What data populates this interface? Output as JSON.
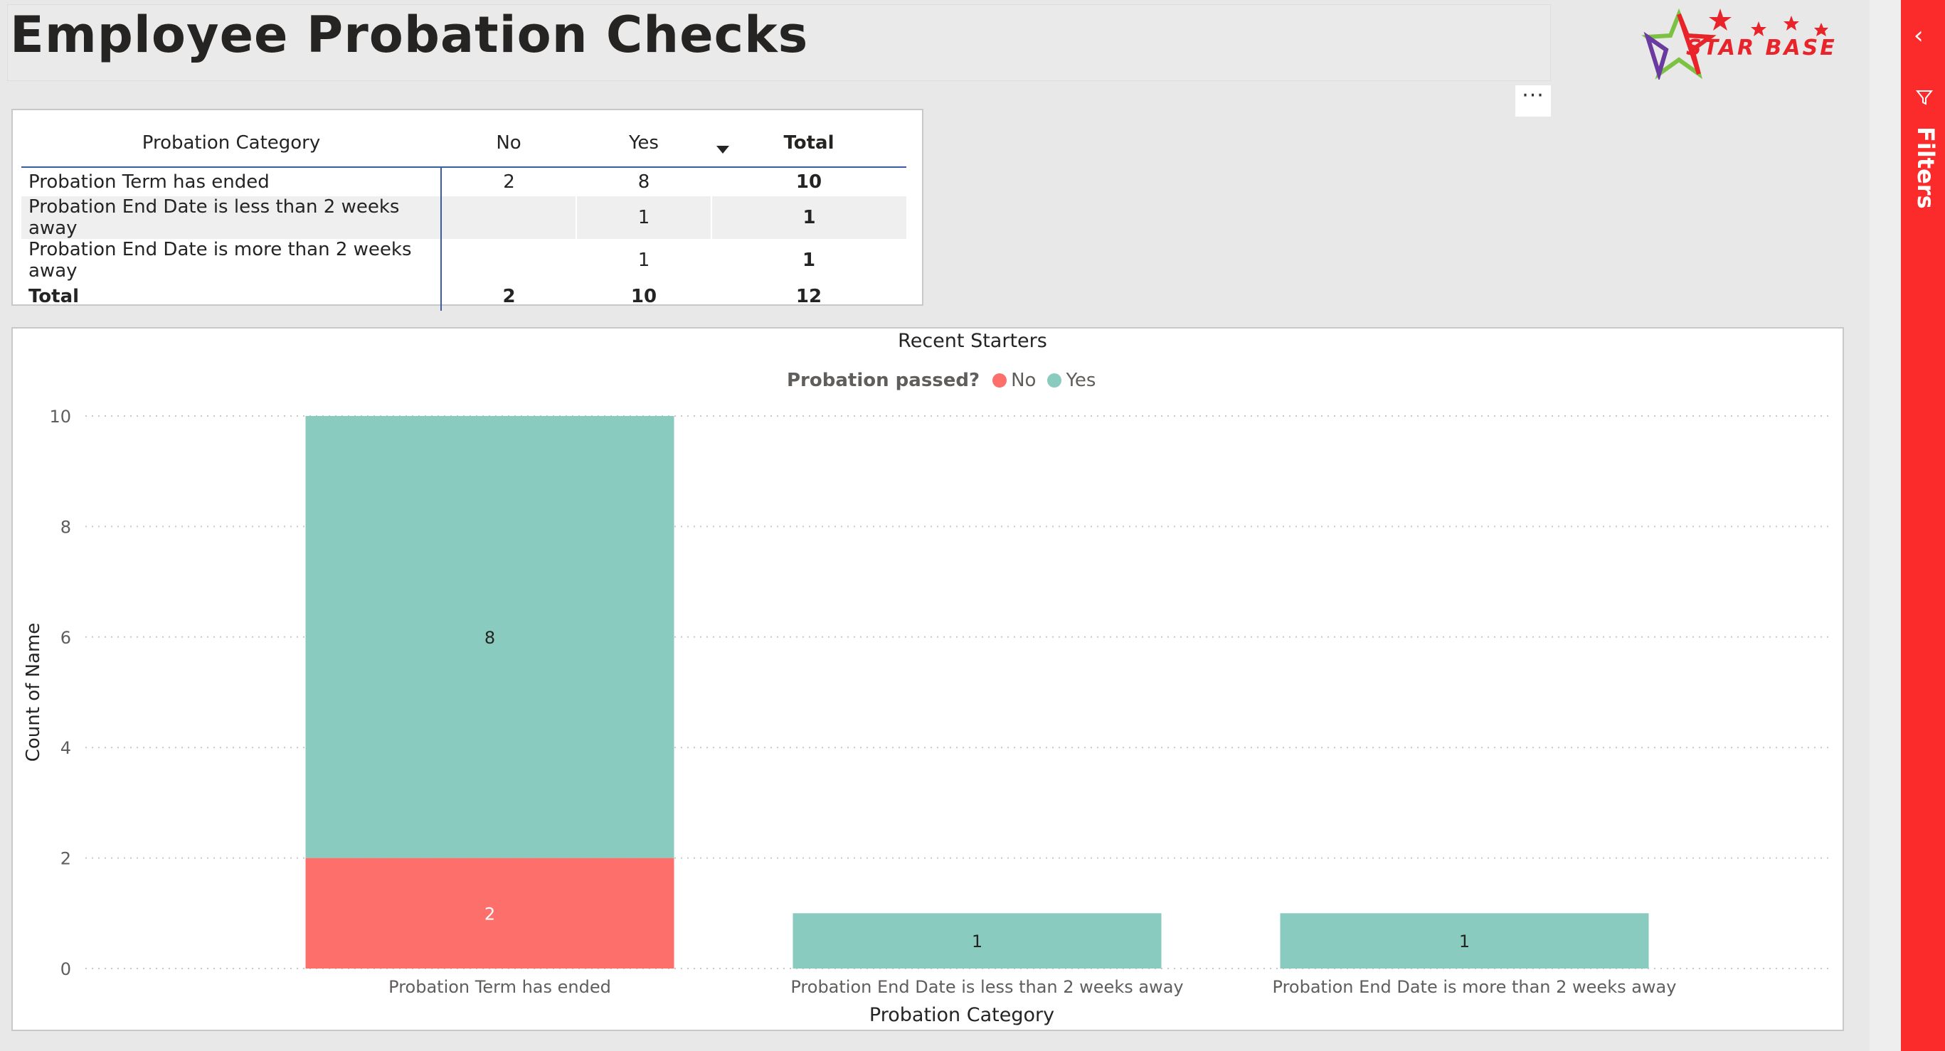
{
  "page": {
    "title": "Employee Probation Checks"
  },
  "logo": {
    "text": "STAR BASE"
  },
  "visual_menu": {
    "more_label": "···"
  },
  "filters_pane": {
    "label": "Filters",
    "collapse_icon": "chevron-left-icon",
    "filter_icon": "funnel-icon"
  },
  "matrix": {
    "headers": [
      "Probation Category",
      "No",
      "Yes",
      "Total"
    ],
    "rows": [
      {
        "category": "Probation Term has ended",
        "no": "2",
        "yes": "8",
        "total": "10"
      },
      {
        "category": "Probation End Date is less than 2 weeks away",
        "no": "",
        "yes": "1",
        "total": "1"
      },
      {
        "category": "Probation End Date is more than 2 weeks away",
        "no": "",
        "yes": "1",
        "total": "1"
      }
    ],
    "total_row": {
      "label": "Total",
      "no": "2",
      "yes": "10",
      "total": "12"
    }
  },
  "chart_data": {
    "type": "bar",
    "stacked": true,
    "title": "Recent Starters",
    "legend_title": "Probation passed?",
    "legend_position": "top-center",
    "categories": [
      "Probation Term has ended",
      "Probation End Date is less than 2 weeks away",
      "Probation End Date is more than 2 weeks away"
    ],
    "series": [
      {
        "name": "No",
        "color": "#fd6f6b",
        "values": [
          2,
          0,
          0
        ]
      },
      {
        "name": "Yes",
        "color": "#89cbbf",
        "values": [
          8,
          1,
          1
        ]
      }
    ],
    "xlabel": "Probation Category",
    "ylabel": "Count of Name",
    "ylim": [
      0,
      10
    ],
    "yticks": [
      0,
      2,
      4,
      6,
      8,
      10
    ],
    "grid": true
  }
}
